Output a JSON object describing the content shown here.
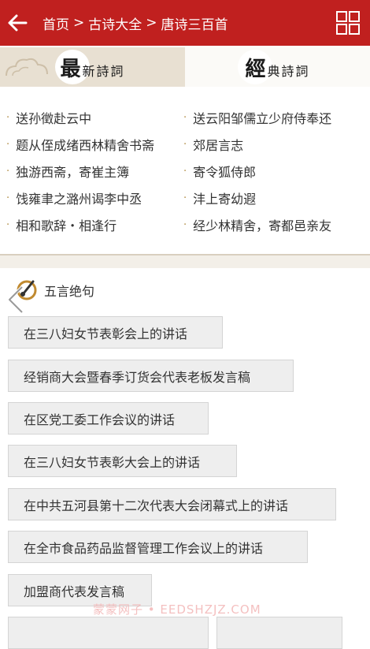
{
  "header": {
    "breadcrumb": [
      "首页",
      "古诗大全",
      "唐诗三百首"
    ],
    "separator": ">"
  },
  "tabs": [
    {
      "big": "最",
      "rest": "新詩詞"
    },
    {
      "big": "經",
      "rest": "典詩詞"
    }
  ],
  "latest": {
    "left": [
      "送孙徵赴云中",
      "题从侄成绪西林精舍书斋",
      "独游西斋，寄崔主簿",
      "饯雍聿之潞州谒李中丞",
      "相和歌辞・相逢行"
    ],
    "right": [
      "送云阳邹儒立少府侍奉还",
      "郊居言志",
      "寄令狐侍郎",
      "沣上寄幼遐",
      "经少林精舍，寄都邑亲友"
    ]
  },
  "section": {
    "title": "五言绝句"
  },
  "items": [
    "在三八妇女节表彰会上的讲话",
    "经销商大会暨春季订货会代表老板发言稿",
    "在区党工委工作会议的讲话",
    "在三八妇女节表彰大会上的讲话",
    "在中共五河县第十二次代表大会闭幕式上的讲话",
    "在全市食品药品监督管理工作会议上的讲话",
    "加盟商代表发言稿"
  ],
  "watermark": "蒙蒙网子 • EEDSHZJZ.COM"
}
